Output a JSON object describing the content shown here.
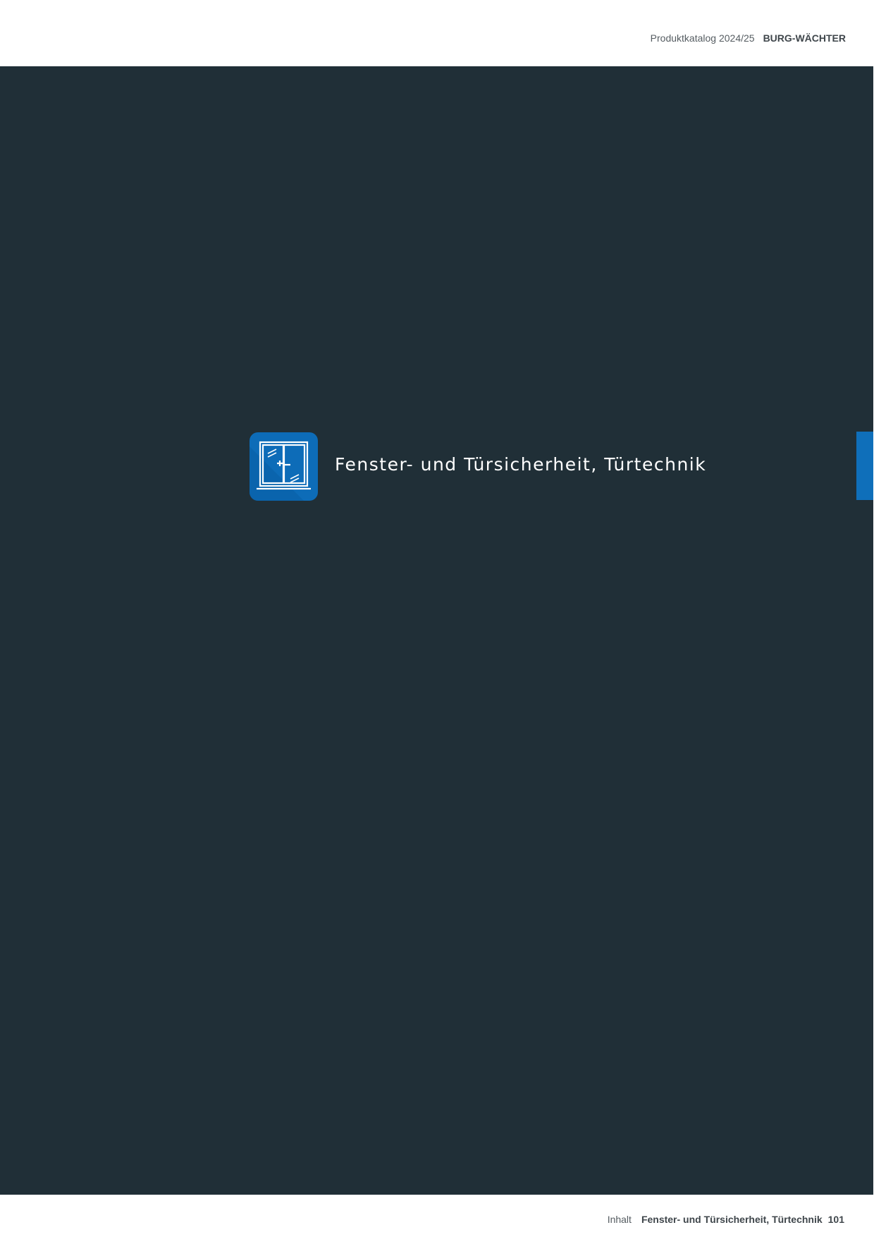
{
  "header": {
    "catalog": "Produktkatalog 2024/25",
    "brand": "BURG-WÄCHTER"
  },
  "section": {
    "title": "Fenster- und Türsicherheit, Türtechnik",
    "icon": "window-icon",
    "accent_color": "#0f6fba",
    "background_color": "#202f37"
  },
  "footer": {
    "label": "Inhalt",
    "title": "Fenster- und Türsicherheit, Türtechnik",
    "page_number": "101"
  }
}
